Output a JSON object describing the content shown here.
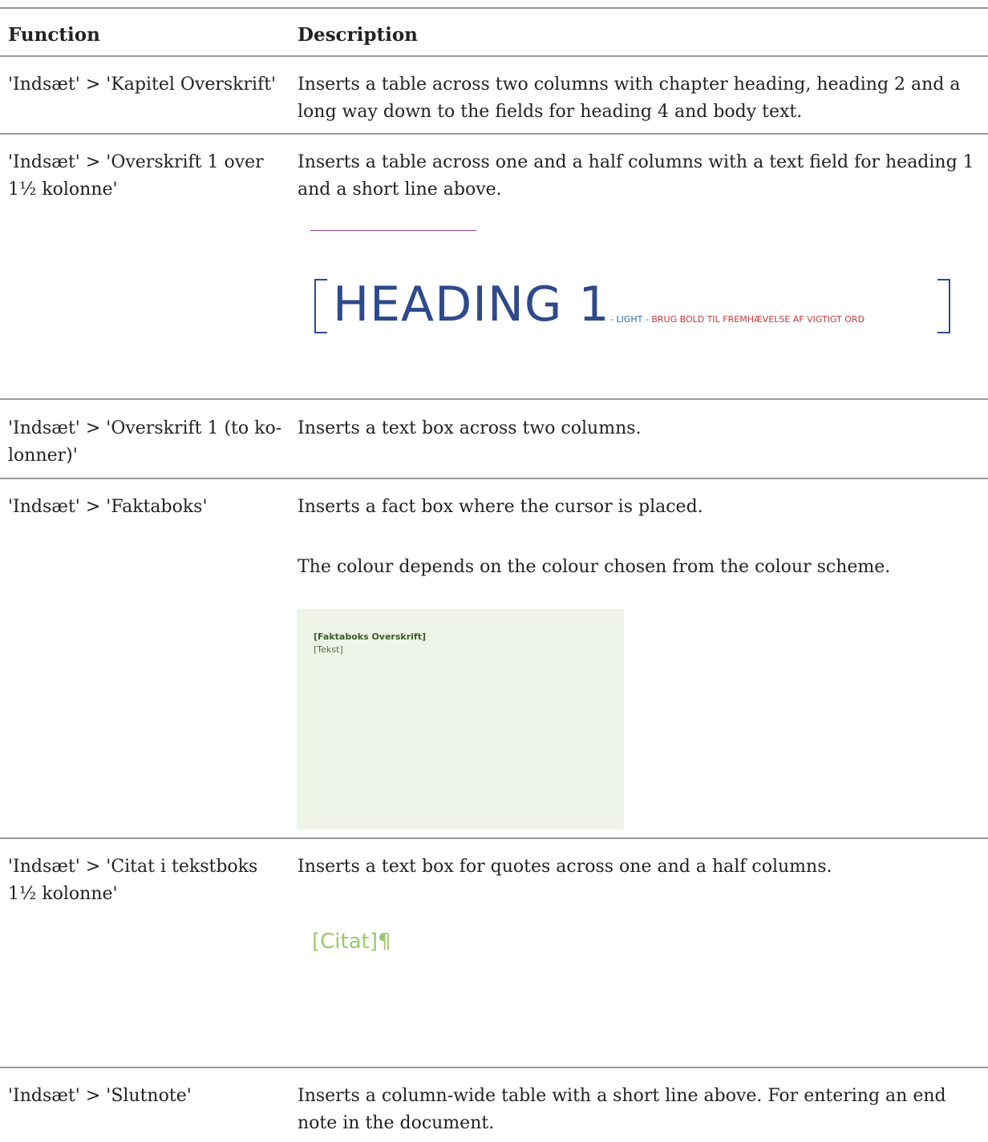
{
  "header": {
    "col1": "Function",
    "col2": "Description"
  },
  "rows": [
    {
      "function": "'Indsæt' > 'Kapitel Overskrift'",
      "description": "Inserts a table across two columns with chapter heading, heading 2 and a long way down to the fields for heading 4 and body text."
    },
    {
      "function": "'Indsæt' > 'Overskrift 1 over 1½ kolonne'",
      "description": "Inserts a table across one and a half columns with a text field for heading 1 and a short line above."
    },
    {
      "function": "'Indsæt' > 'Overskrift 1 (to ko-lonner)'",
      "description": "Inserts a text box across two columns."
    },
    {
      "function": "'Indsæt' > 'Faktaboks'",
      "description": "Inserts a fact box where the cursor is placed.",
      "description2": "The colour depends on the colour chosen from the colour scheme."
    },
    {
      "function": "'Indsæt' > 'Citat i tekstboks 1½ kolonne'",
      "description": "Inserts a text box for quotes across one and a half columns."
    },
    {
      "function": "'Indsæt' > 'Slutnote'",
      "description": "Inserts a column-wide table with a short line above. For entering an end note in the document."
    }
  ],
  "heading_sample": {
    "text": "HEADING 1",
    "sub_light": "- LIGHT -",
    "sub_bold": "BRUG BOLD TIL FREMHÆVELSE AF VIGTIGT ORD",
    "color": "#2e4a8a"
  },
  "factbox": {
    "title": "[Faktaboks Overskrift]",
    "text": "[Tekst]",
    "background": "#eef4e6"
  },
  "citat": {
    "text": "[Citat]¶",
    "color": "#9cc86a"
  }
}
